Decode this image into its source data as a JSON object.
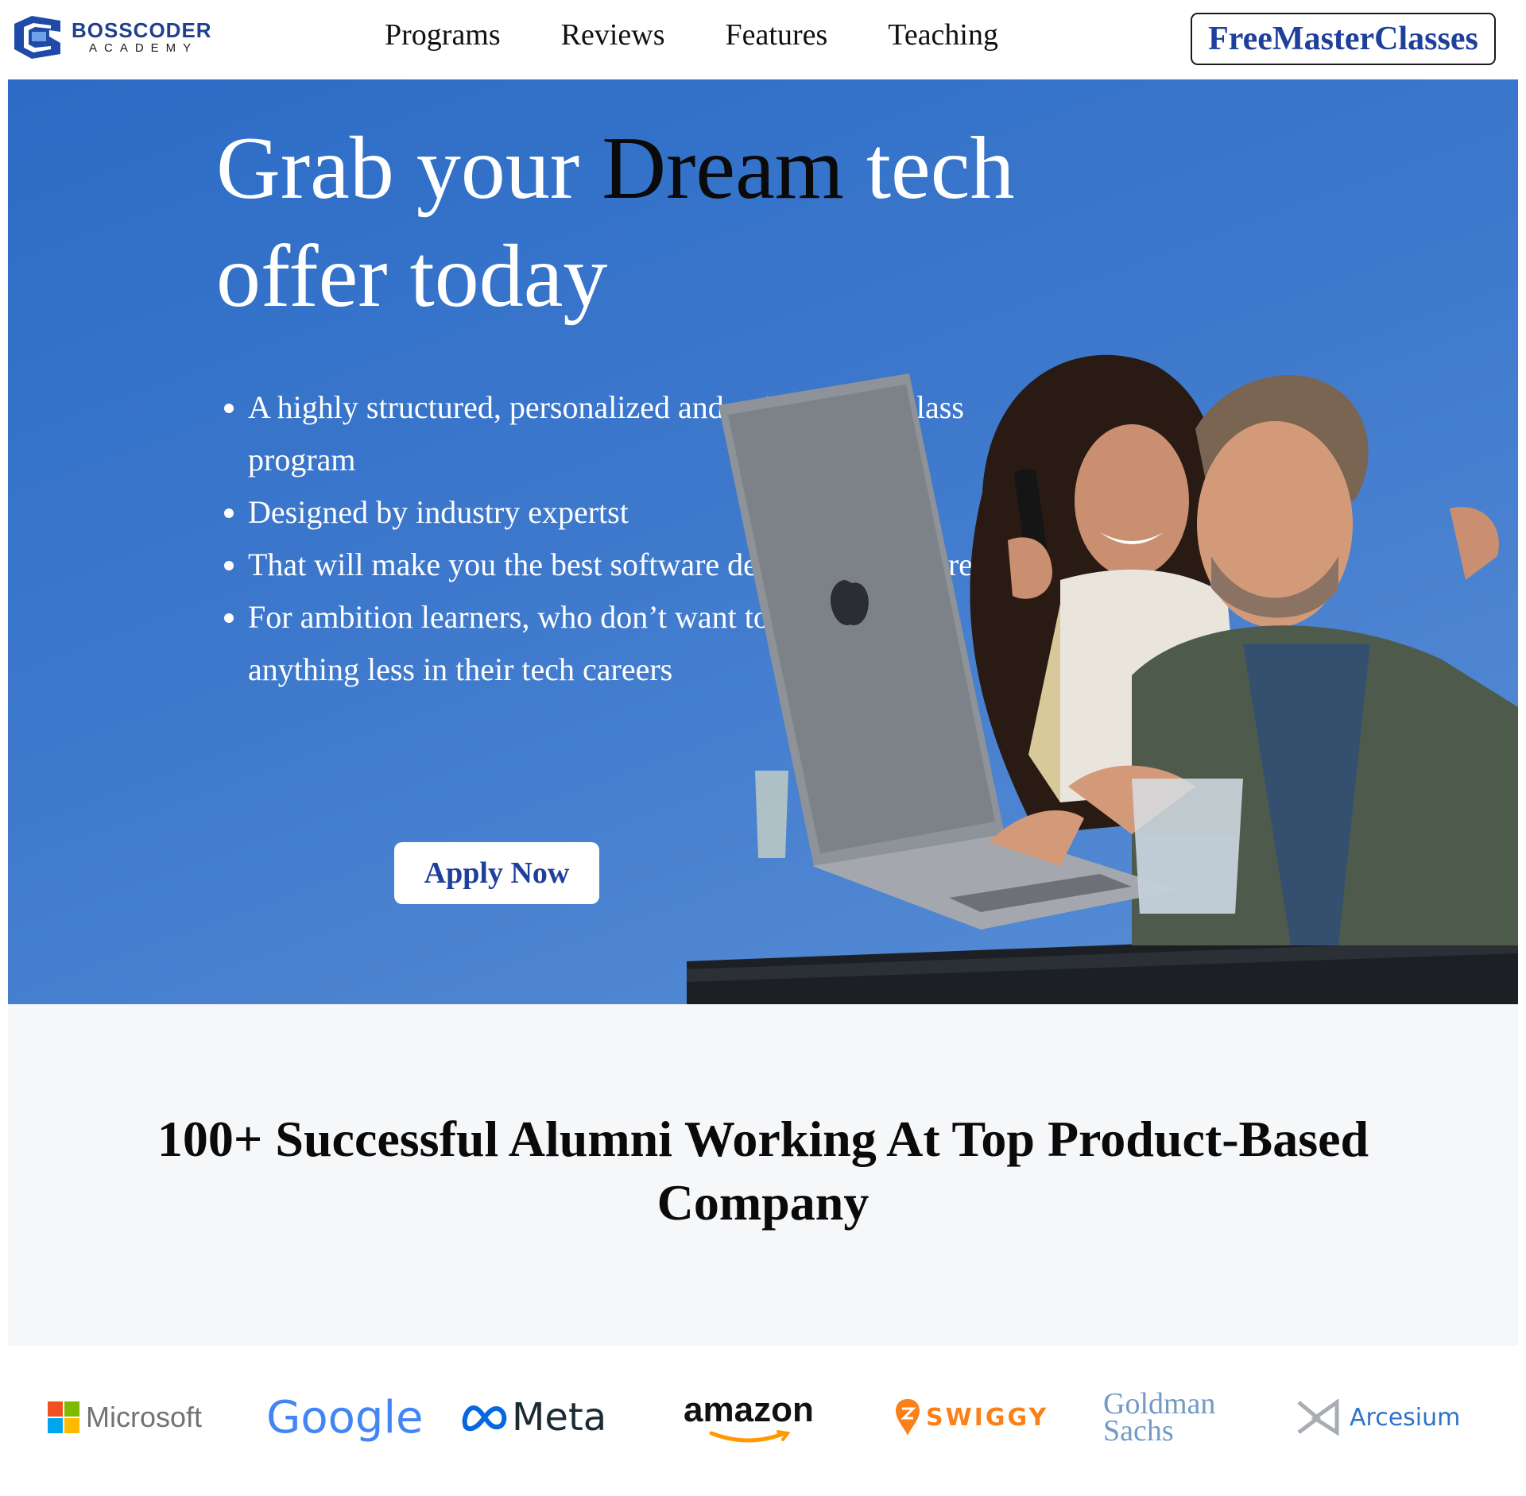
{
  "brand": {
    "name": "BOSSCODER",
    "sub": "ACADEMY",
    "color": "#1f3f8f"
  },
  "nav": {
    "links": [
      "Programs",
      "Reviews",
      "Features",
      "Teaching"
    ],
    "cta": "FreeMasterClasses"
  },
  "hero": {
    "title_part1": "Grab your ",
    "title_highlight": "Dream",
    "title_part2": " tech offer today",
    "bullets": [
      "A highly structured, personalized and guided word-class program",
      "Designed by industry expertst",
      "That will make you the best software developer out there",
      "For ambition learners, who don’t want to settle for anything less in their tech careers"
    ],
    "apply_label": "Apply Now",
    "background_color": "#3d78cc"
  },
  "alumni": {
    "heading": "100+ Successful Alumni Working At Top Product-Based Company",
    "companies": [
      {
        "name": "Microsoft",
        "icon": "microsoft-logo-icon"
      },
      {
        "name": "Google",
        "icon": "google-logo-icon"
      },
      {
        "name": "Meta",
        "icon": "meta-logo-icon"
      },
      {
        "name": "amazon",
        "icon": "amazon-logo-icon"
      },
      {
        "name": "SWIGGY",
        "icon": "swiggy-logo-icon"
      },
      {
        "name": "Goldman Sachs",
        "icon": "goldman-sachs-logo-icon"
      },
      {
        "name": "Arcesium",
        "icon": "arcesium-logo-icon"
      }
    ]
  }
}
